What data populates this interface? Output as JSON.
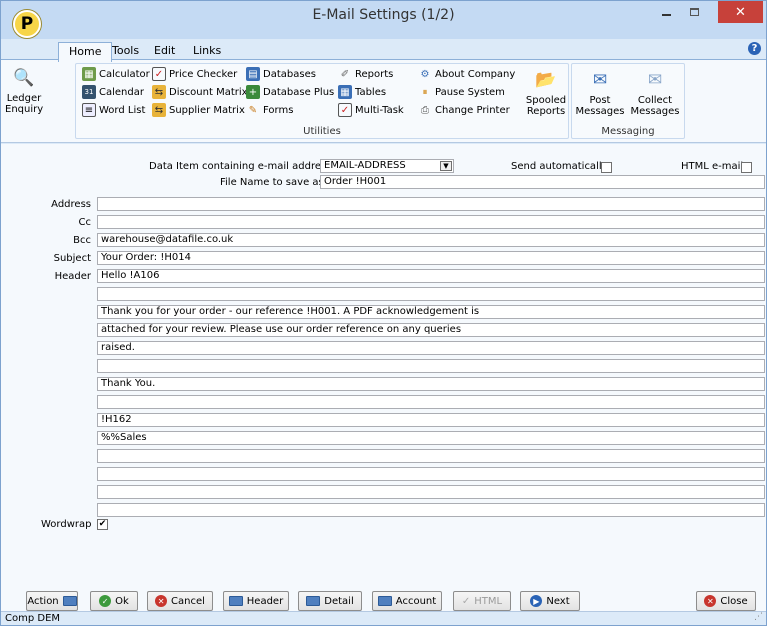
{
  "window": {
    "title": "E-Mail Settings (1/2)",
    "logo_letter": "P"
  },
  "menu": {
    "tabs": [
      "Home",
      "Tools",
      "Edit",
      "Links"
    ]
  },
  "ribbon": {
    "ledger_enquiry": "Ledger\nEnquiry",
    "utilities": {
      "label": "Utilities",
      "items": [
        "Calculator",
        "Calendar",
        "Word List",
        "Price Checker",
        "Discount Matrix",
        "Supplier Matrix",
        "Databases",
        "Database Plus",
        "Forms",
        "Reports",
        "Tables",
        "Multi-Task",
        "About Company",
        "Pause System",
        "Change Printer"
      ],
      "spooled_reports": "Spooled\nReports"
    },
    "messaging": {
      "label": "Messaging",
      "post_messages": "Post\nMessages",
      "collect_messages": "Collect\nMessages"
    }
  },
  "form": {
    "data_item_label": "Data Item containing e-mail address",
    "data_item_value": "EMAIL-ADDRESS",
    "send_auto_label": "Send automatically",
    "send_auto_checked": false,
    "html_email_label": "HTML e-mail",
    "html_email_checked": false,
    "file_name_label": "File Name to save as",
    "file_name_value": "Order !H001",
    "address_label": "Address",
    "address_value": "",
    "cc_label": "Cc",
    "cc_value": "",
    "bcc_label": "Bcc",
    "bcc_value": "warehouse@datafile.co.uk",
    "subject_label": "Subject",
    "subject_value": "Your Order: !H014",
    "header_label": "Header",
    "header_lines": [
      "Hello !A106",
      "",
      "Thank you for your order - our reference !H001.  A PDF acknowledgement is",
      "attached for your review.  Please use our order reference on any queries",
      "raised.",
      "",
      "Thank You.",
      "",
      "!H162",
      "%%Sales",
      "",
      "",
      "",
      ""
    ],
    "wordwrap_label": "Wordwrap",
    "wordwrap_checked": "✔"
  },
  "buttons": {
    "action": "Action",
    "ok": "Ok",
    "cancel": "Cancel",
    "header": "Header",
    "detail": "Detail",
    "account": "Account",
    "html": "HTML",
    "next": "Next",
    "close": "Close"
  },
  "status": {
    "company": "Comp DEM"
  }
}
